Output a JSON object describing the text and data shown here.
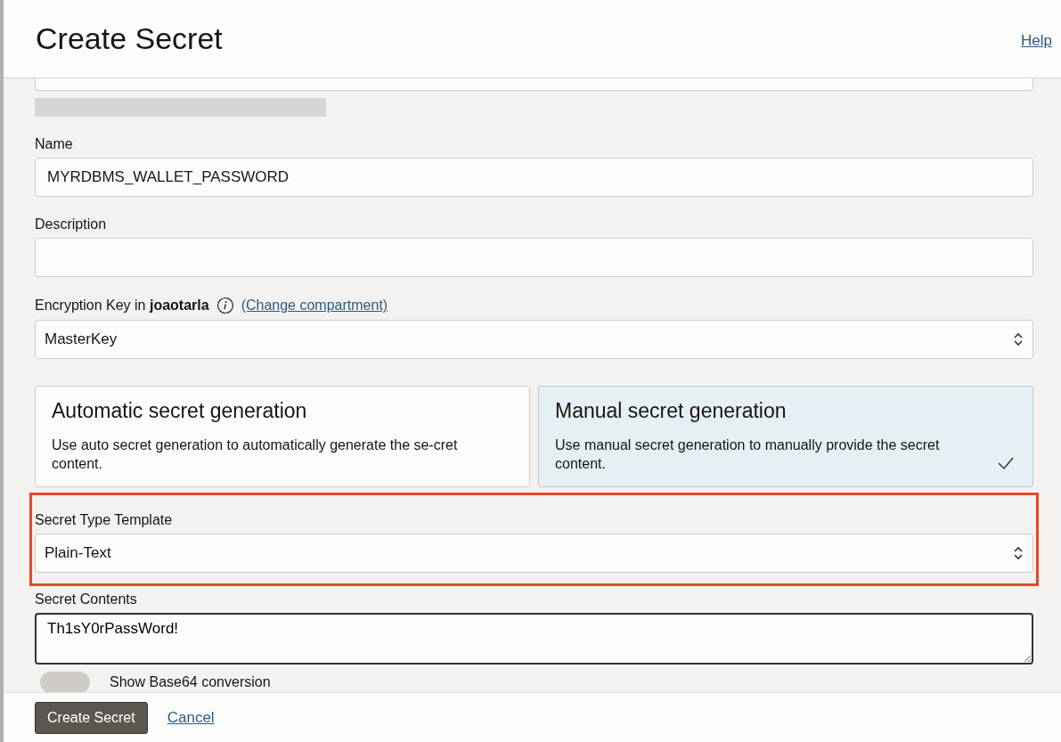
{
  "panel": {
    "title": "Create Secret",
    "help_link": "Help"
  },
  "form": {
    "name": {
      "label": "Name",
      "value": "MYRDBMS_WALLET_PASSWORD"
    },
    "description": {
      "label": "Description"
    },
    "encryption_key": {
      "label": "Encryption Key in **joaotarla**",
      "link": "(Change compartment)",
      "value": "MasterKey"
    },
    "generation_options": [
      {
        "title": "Automatic secret generation",
        "text": "Use auto secret generation to automatically generate the se-cret content.",
        "selected": false
      },
      {
        "title": "Manual secret generation",
        "text": "Use manual secret generation to manually provide the secret content.",
        "selected": true
      }
    ],
    "secret_type_template": {
      "label": "Secret Type Template",
      "value": "Plain-Text",
      "highlighted": true
    },
    "secret_contents": {
      "label": "Secret Contents",
      "value": "Th1sY0rPassWord!"
    },
    "base64_toggle": {
      "label": "Show Base64 conversion",
      "on": false
    }
  },
  "footer": {
    "buttons": [
      "Create Secret"
    ],
    "cancel_link": "Cancel"
  }
}
